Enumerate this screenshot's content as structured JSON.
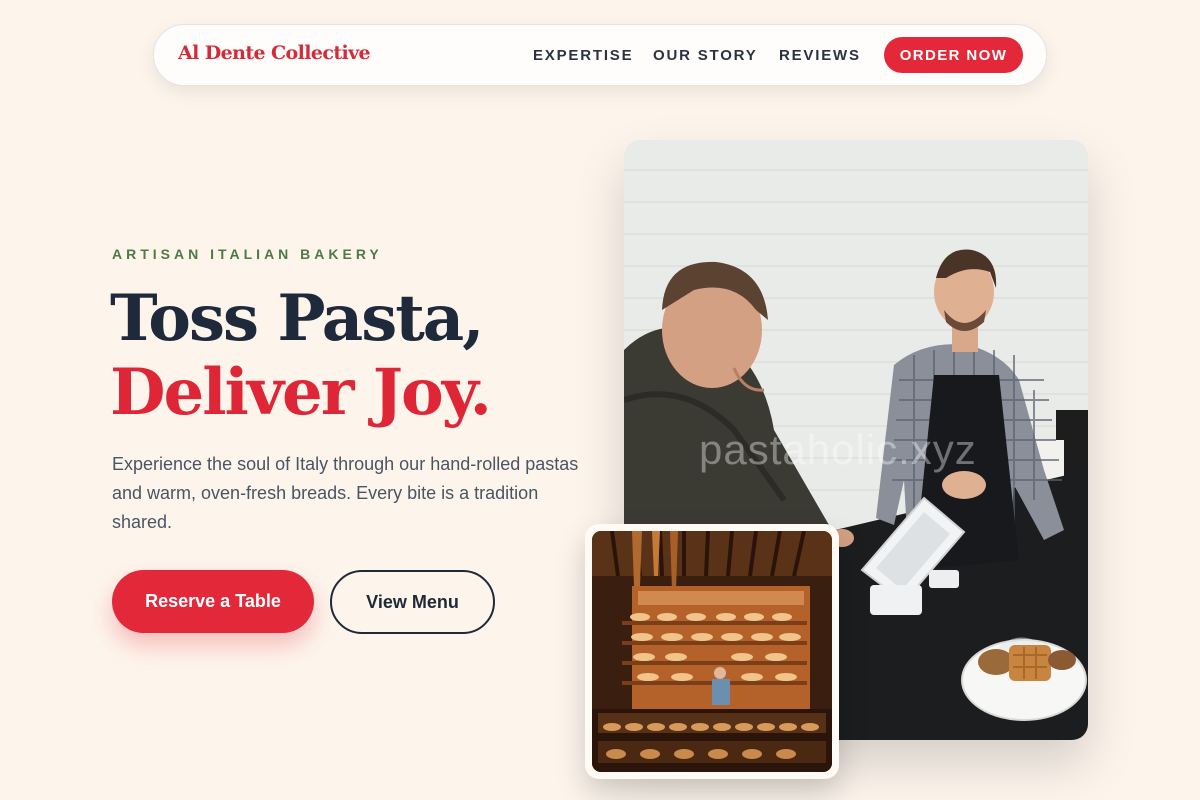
{
  "nav": {
    "brand": "Al Dente Collective",
    "links": [
      {
        "label": "EXPERTISE"
      },
      {
        "label": "OUR STORY"
      },
      {
        "label": "REVIEWS"
      }
    ],
    "cta": "ORDER NOW"
  },
  "hero": {
    "eyebrow": "ARTISAN ITALIAN BAKERY",
    "headline_line1": "Toss Pasta,",
    "headline_line2": "Deliver Joy.",
    "description": "Experience the soul of Italy through our hand-rolled pastas and warm, oven-fresh breads. Every bite is a tradition shared.",
    "primary_button": "Reserve a Table",
    "secondary_button": "View Menu"
  },
  "images": {
    "main_watermark": "pastaholic.xyz",
    "main_photo": "photo-bakery-counter",
    "small_photo": "photo-pastry-display"
  },
  "colors": {
    "accent": "#e3283a",
    "headline_dark": "#1e2a3b",
    "eyebrow_green": "#4f7a43",
    "background": "#fdf5ec"
  }
}
